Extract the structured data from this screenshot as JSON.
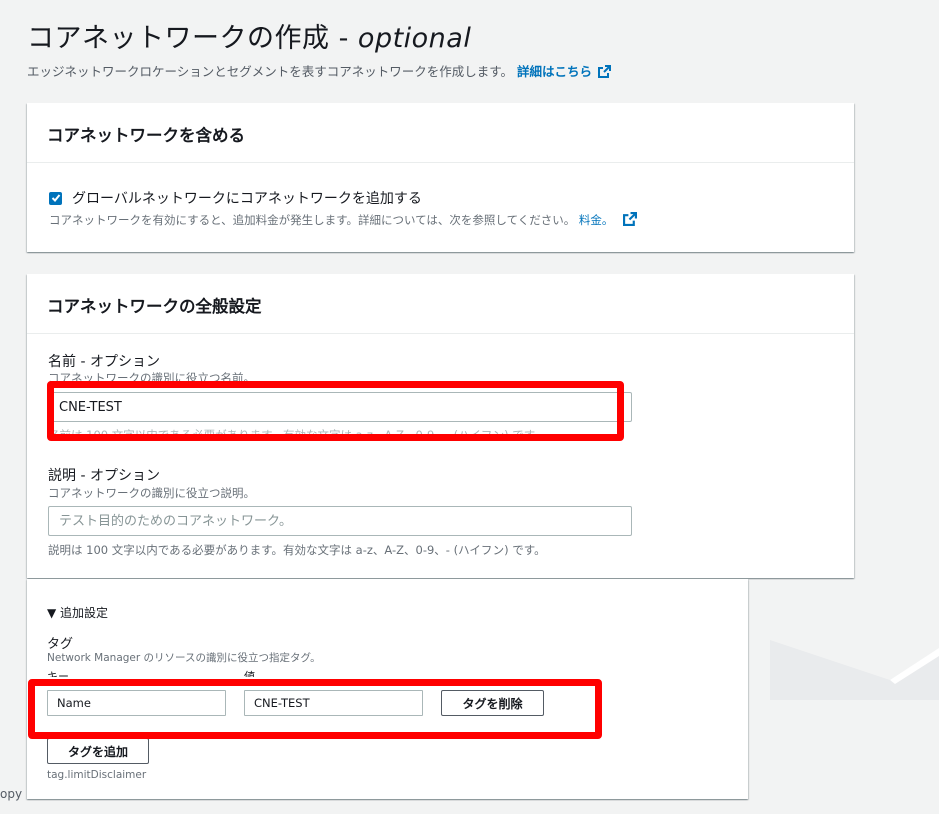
{
  "header": {
    "title_main": "コアネットワークの作成 - ",
    "title_optional": "optional",
    "description": "エッジネットワークロケーションとセグメントを表すコアネットワークを作成します。",
    "learn_more_link": "詳細はこちら"
  },
  "include_panel": {
    "title": "コアネットワークを含める",
    "checkbox_label": "グローバルネットワークにコアネットワークを追加する",
    "checkbox_checked": true,
    "checkbox_desc": "コアネットワークを有効にすると、追加料金が発生します。詳細については、次を参照してください。",
    "pricing_link": "料金。"
  },
  "general_panel": {
    "title": "コアネットワークの全般設定",
    "name_label": "名前 - オプション",
    "name_desc": "コアネットワークの識別に役立つ名前。",
    "name_value": "CNE-TEST",
    "name_constraint": "名前は 100 文字以内である必要があります。有効な文字は a-z、A-Z、0-9、- (ハイフン) です。",
    "description_label": "説明 - オプション",
    "description_desc": "コアネットワークの識別に役立つ説明。",
    "description_placeholder": "テスト目的のためのコアネットワーク。",
    "description_constraint": "説明は 100 文字以内である必要があります。有効な文字は a-z、A-Z、0-9、- (ハイフン) です。"
  },
  "additional_panel": {
    "toggle_label": "▼ 追加設定",
    "tags_label": "タグ",
    "tags_desc": "Network Manager のリソースの識別に役立つ指定タグ。",
    "key_header": "キー",
    "value_header": "値",
    "tag_key": "Name",
    "tag_value": "CNE-TEST",
    "remove_tag_button": "タグを削除",
    "add_tag_button": "タグを追加",
    "limit_disclaimer": "tag.limitDisclaimer"
  },
  "edge_text": "opy",
  "colors": {
    "highlight": "#ff0000",
    "link": "#0073bb",
    "checkbox": "#0073bb"
  }
}
